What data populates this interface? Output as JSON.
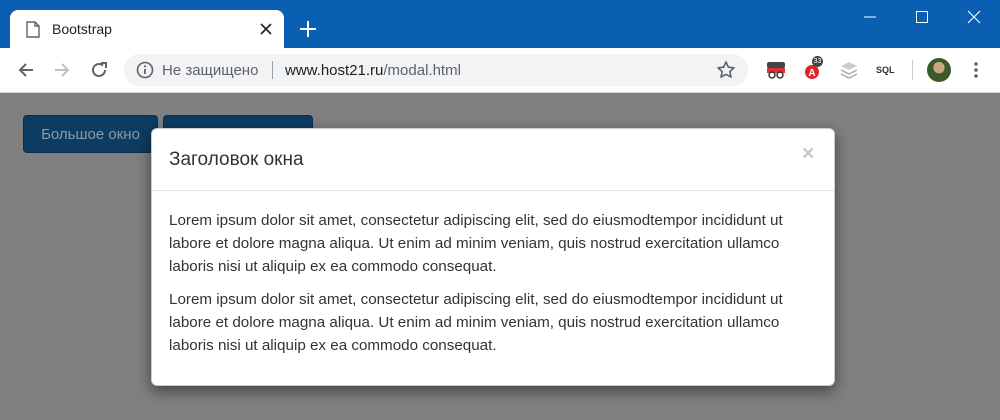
{
  "browser": {
    "tab_title": "Bootstrap",
    "security_label": "Не защищено",
    "url_host": "www.host21.ru",
    "url_path": "/modal.html",
    "extension_sql_label": "SQL",
    "extension_badge": "33",
    "titlebar_color": "#0b5fb3"
  },
  "page": {
    "buttons": {
      "large_label": "Большое окно",
      "second_label": ""
    },
    "overlay_color": "#808080"
  },
  "modal": {
    "title": "Заголовок окна",
    "close_label": "×",
    "paragraphs": [
      "Lorem ipsum dolor sit amet, consectetur adipiscing elit, sed do eiusmodtempor incididunt ut labore et dolore magna aliqua. Ut enim ad minim veniam, quis nostrud exercitation ullamco laboris nisi ut aliquip ex ea commodo consequat.",
      "Lorem ipsum dolor sit amet, consectetur adipiscing elit, sed do eiusmodtempor incididunt ut labore et dolore magna aliqua. Ut enim ad minim veniam, quis nostrud exercitation ullamco laboris nisi ut aliquip ex ea commodo consequat."
    ]
  }
}
